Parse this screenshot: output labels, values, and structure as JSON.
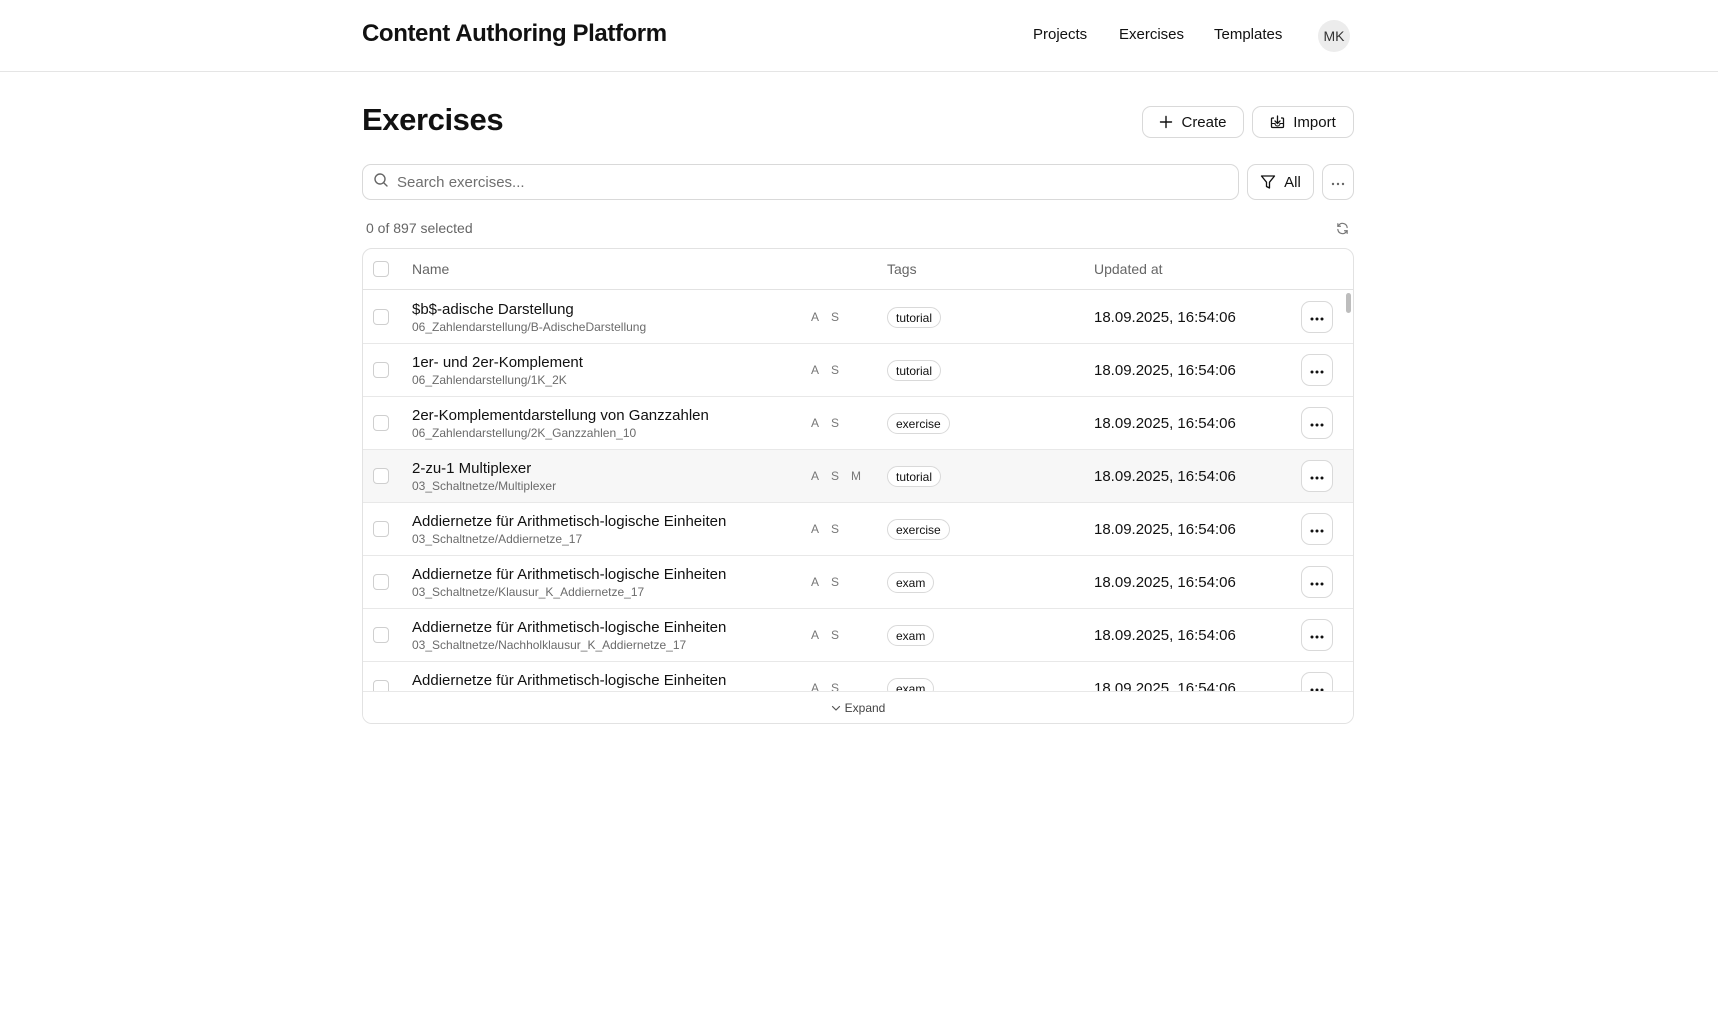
{
  "header": {
    "app_title": "Content Authoring Platform",
    "nav": [
      "Projects",
      "Exercises",
      "Templates"
    ],
    "avatar_initials": "MK"
  },
  "page": {
    "title": "Exercises",
    "create_label": "Create",
    "import_label": "Import"
  },
  "toolbar": {
    "search_placeholder": "Search exercises...",
    "search_value": "",
    "filter_label": "All",
    "selection_text": "0 of 897 selected"
  },
  "table": {
    "columns": {
      "name": "Name",
      "tags": "Tags",
      "updated": "Updated at"
    },
    "expand_label": "Expand",
    "rows": [
      {
        "name": "$b$-adische Darstellung",
        "path": "06_Zahlendarstellung/B-AdischeDarstellung",
        "flags": [
          "A",
          "S"
        ],
        "tag": "tutorial",
        "updated": "18.09.2025, 16:54:06"
      },
      {
        "name": "1er- und 2er-Komplement",
        "path": "06_Zahlendarstellung/1K_2K",
        "flags": [
          "A",
          "S"
        ],
        "tag": "tutorial",
        "updated": "18.09.2025, 16:54:06"
      },
      {
        "name": "2er-Komplementdarstellung von Ganzzahlen",
        "path": "06_Zahlendarstellung/2K_Ganzzahlen_10",
        "flags": [
          "A",
          "S"
        ],
        "tag": "exercise",
        "updated": "18.09.2025, 16:54:06"
      },
      {
        "name": "2-zu-1 Multiplexer",
        "path": "03_Schaltnetze/Multiplexer",
        "flags": [
          "A",
          "S",
          "M"
        ],
        "tag": "tutorial",
        "updated": "18.09.2025, 16:54:06"
      },
      {
        "name": "Addiernetze für Arithmetisch-logische Einheiten",
        "path": "03_Schaltnetze/Addiernetze_17",
        "flags": [
          "A",
          "S"
        ],
        "tag": "exercise",
        "updated": "18.09.2025, 16:54:06"
      },
      {
        "name": "Addiernetze für Arithmetisch-logische Einheiten",
        "path": "03_Schaltnetze/Klausur_K_Addiernetze_17",
        "flags": [
          "A",
          "S"
        ],
        "tag": "exam",
        "updated": "18.09.2025, 16:54:06"
      },
      {
        "name": "Addiernetze für Arithmetisch-logische Einheiten",
        "path": "03_Schaltnetze/Nachholklausur_K_Addiernetze_17",
        "flags": [
          "A",
          "S"
        ],
        "tag": "exam",
        "updated": "18.09.2025, 16:54:06"
      },
      {
        "name": "Addiernetze für Arithmetisch-logische Einheiten",
        "path": "",
        "flags": [
          "A",
          "S"
        ],
        "tag": "exam",
        "updated": "18.09.2025, 16:54:06"
      }
    ]
  }
}
